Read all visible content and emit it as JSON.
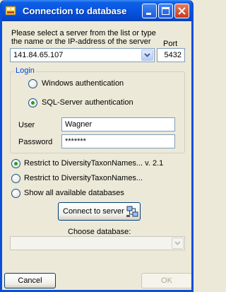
{
  "window": {
    "title": "Connection to database"
  },
  "server": {
    "instruction": "Please select a server from the list or type the name or the IP-address of the server",
    "port_label": "Port",
    "address": "141.84.65.107",
    "port": "5432"
  },
  "login": {
    "legend": "Login",
    "windows_auth": "Windows authentication",
    "sql_auth": "SQL-Server authentication",
    "selected": "sql",
    "user_label": "User",
    "user": "Wagner",
    "password_label": "Password",
    "password": "*******"
  },
  "database_filter": {
    "options": [
      "Restrict to DiversityTaxonNames... v. 2.1",
      "Restrict to DiversityTaxonNames...",
      "Show all available databases"
    ],
    "selected": 0
  },
  "connect": {
    "label": "Connect to server"
  },
  "choose": {
    "label": "Choose database:",
    "value": ""
  },
  "footer": {
    "cancel": "Cancel",
    "ok": "OK"
  },
  "colors": {
    "title_bar": "#0755e0",
    "group_legend": "#0046d5",
    "radio_dot": "#21a121"
  }
}
